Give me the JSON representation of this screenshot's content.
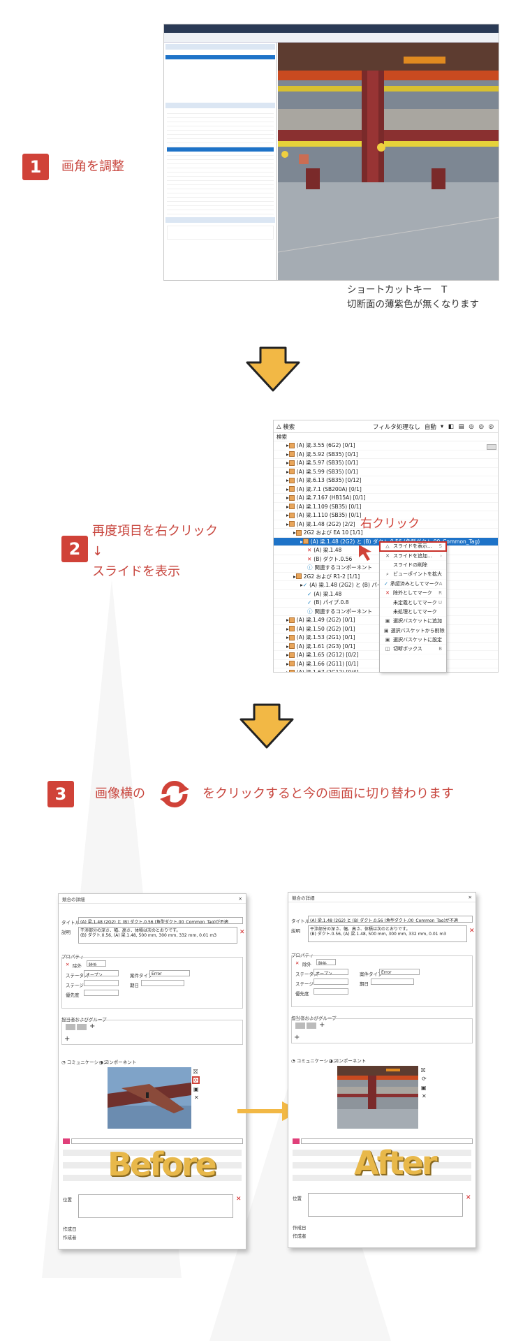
{
  "steps": [
    {
      "number": "1",
      "label": "画角を調整"
    },
    {
      "number": "2",
      "label_lines": [
        "再度項目を右クリック",
        "↓",
        "スライドを表示"
      ]
    },
    {
      "number": "3",
      "label_before": "画像横の",
      "label_after": "をクリックすると今の画面に切り替わります"
    }
  ],
  "step1_note": {
    "line1": "ショートカットキー　T",
    "line2": "切断面の薄紫色が無くなります"
  },
  "step2_callout": "右クリック",
  "tree_panel": {
    "title": "検索",
    "toolbar_label": "フィルタ処理なし",
    "toolbar_auto": "自動",
    "subheader": "検索",
    "rows": [
      {
        "text": "(A) 梁.3.55 (6G2) [0/1]",
        "indent": 1,
        "kind": "folder"
      },
      {
        "text": "(A) 梁.5.92 (SB35) [0/1]",
        "indent": 1,
        "kind": "folder"
      },
      {
        "text": "(A) 梁.5.97 (SB35) [0/1]",
        "indent": 1,
        "kind": "folder"
      },
      {
        "text": "(A) 梁.5.99 (SB35) [0/1]",
        "indent": 1,
        "kind": "folder"
      },
      {
        "text": "(A) 梁.6.13 (SB35) [0/12]",
        "indent": 1,
        "kind": "folder"
      },
      {
        "text": "(A) 梁.7.1 (SB200A) [0/1]",
        "indent": 1,
        "kind": "folder"
      },
      {
        "text": "(A) 梁.7.167 (HB15A) [0/1]",
        "indent": 1,
        "kind": "folder"
      },
      {
        "text": "(A) 梁.1.109 (SB35) [0/1]",
        "indent": 1,
        "kind": "folder"
      },
      {
        "text": "(A) 梁.1.110 (SB35) [0/1]",
        "indent": 1,
        "kind": "folder"
      },
      {
        "text": "(A) 梁.1.48 (2G2) [2/2]",
        "indent": 1,
        "kind": "folder"
      },
      {
        "text": "2G2 および EA 10 [1/1]",
        "indent": 2,
        "kind": "folder"
      },
      {
        "text": "(A) 梁.1.48 (2G2) と (B) ダクト.0.56 (角型ダクト.00_Common_Tag)",
        "indent": 3,
        "kind": "selected"
      },
      {
        "text": "(A) 梁.1.48",
        "indent": 4,
        "kind": "x"
      },
      {
        "text": "(B) ダクト.0.56",
        "indent": 4,
        "kind": "x"
      },
      {
        "text": "関連するコンポーネント",
        "indent": 4,
        "kind": "info"
      },
      {
        "text": "2G2 および R1-2 [1/1]",
        "indent": 2,
        "kind": "folder"
      },
      {
        "text": "(A) 梁.1.48 (2G2) と (B) パイプ.0.8",
        "indent": 3,
        "kind": "check"
      },
      {
        "text": "(A) 梁.1.48",
        "indent": 4,
        "kind": "check"
      },
      {
        "text": "(B) パイプ.0.8",
        "indent": 4,
        "kind": "check"
      },
      {
        "text": "関連するコンポーネント",
        "indent": 4,
        "kind": "info"
      },
      {
        "text": "(A) 梁.1.49 (2G2) [0/1]",
        "indent": 1,
        "kind": "folder"
      },
      {
        "text": "(A) 梁.1.50 (2G2) [0/1]",
        "indent": 1,
        "kind": "folder"
      },
      {
        "text": "(A) 梁.1.53 (2G1) [0/1]",
        "indent": 1,
        "kind": "folder"
      },
      {
        "text": "(A) 梁.1.61 (2G3) [0/1]",
        "indent": 1,
        "kind": "folder"
      },
      {
        "text": "(A) 梁.1.65 (2G12) [0/2]",
        "indent": 1,
        "kind": "folder"
      },
      {
        "text": "(A) 梁.1.66 (2G11) [0/1]",
        "indent": 1,
        "kind": "folder"
      },
      {
        "text": "(A) 梁.1.67 (2G12) [0/4]",
        "indent": 1,
        "kind": "folder"
      }
    ]
  },
  "context_menu": [
    {
      "icon": "slide-icon",
      "glyph": "△",
      "label": "スライドを表示...",
      "shortcut": "S",
      "highlight": true
    },
    {
      "icon": "slide-add-icon",
      "glyph": "✕",
      "label": "スライドを追加...",
      "shortcut": "›"
    },
    {
      "icon": "blank",
      "glyph": "",
      "label": "スライドの削除",
      "shortcut": ""
    },
    {
      "icon": "zoom-icon",
      "glyph": "⌕",
      "label": "ビューポイントを拡大",
      "shortcut": ""
    },
    {
      "icon": "check-icon",
      "glyph": "✓",
      "label": "承認済みとしてマーク",
      "shortcut": "A"
    },
    {
      "icon": "x-icon",
      "glyph": "✕",
      "label": "除外としてマーク",
      "shortcut": "R"
    },
    {
      "icon": "blank",
      "glyph": "",
      "label": "未定義としてマーク",
      "shortcut": "U"
    },
    {
      "icon": "blank",
      "glyph": "",
      "label": "未処理としてマーク",
      "shortcut": ""
    },
    {
      "icon": "basket-icon",
      "glyph": "▣",
      "label": "選択バスケットに追加",
      "shortcut": ""
    },
    {
      "icon": "basket-icon",
      "glyph": "▣",
      "label": "選択バスケットから削除",
      "shortcut": ""
    },
    {
      "icon": "basket-icon",
      "glyph": "▣",
      "label": "選択バスケットに設定",
      "shortcut": ""
    },
    {
      "icon": "section-box-icon",
      "glyph": "◫",
      "label": "切断ボックス",
      "shortcut": "B"
    }
  ],
  "dialogs": [
    {
      "id": "before",
      "caption": "Before",
      "window_title": "競合の詳細",
      "title_label": "タイトル",
      "title_value": "(A) 梁.1.48 (2G2) と (B) ダクト.0.56 (角型ダクト.00_Common_Tag)が不適",
      "desc_label": "説明",
      "desc_lines": [
        "干渉部分の深さ、幅、高さ、体積は次のとおりです。",
        "(B) ダクト.0.56, (A) 梁.1.48, 500 mm, 300 mm, 332 mm, 0.01 m3"
      ],
      "props_label": "プロパティ",
      "state_label": "除外",
      "state_value": "除外",
      "status_label": "ステータス",
      "status_value": "オープン",
      "type_label": "案件タイプ",
      "type_value": "Error",
      "stage_label": "ステージ",
      "due_label": "期日",
      "priority_label": "優先度",
      "assign_label": "担当者およびグループ",
      "tab_comm": "コミュニケーション",
      "tab_comp": "コンポーネント",
      "location_label": "位置",
      "created_label": "作成日",
      "author_label": "作成者"
    },
    {
      "id": "after",
      "caption": "After",
      "window_title": "競合の詳細",
      "title_label": "タイトル",
      "title_value": "(A) 梁.1.48 (2G2) と (B) ダクト.0.56 (角型ダクト.00_Common_Tag)が不適",
      "desc_label": "説明",
      "desc_lines": [
        "干渉部分の深さ、幅、高さ、体積は次のとおりです。",
        "(B) ダクト.0.56, (A) 梁.1.48, 500 mm, 300 mm, 332 mm, 0.01 m3"
      ],
      "props_label": "プロパティ",
      "state_label": "除外",
      "state_value": "除外",
      "status_label": "ステータス",
      "status_value": "オープン",
      "type_label": "案件タイプ",
      "type_value": "Error",
      "stage_label": "ステージ",
      "due_label": "期日",
      "priority_label": "優先度",
      "assign_label": "担当者およびグループ",
      "tab_comm": "コミュニケーション",
      "tab_comp": "コンポーネント",
      "location_label": "位置",
      "created_label": "作成日",
      "author_label": "作成者"
    }
  ],
  "colors": {
    "accent_red": "#d04238",
    "arrow_yellow": "#f2b845",
    "caption_gold": "#e8b84a",
    "selection_blue": "#1e73c8"
  }
}
